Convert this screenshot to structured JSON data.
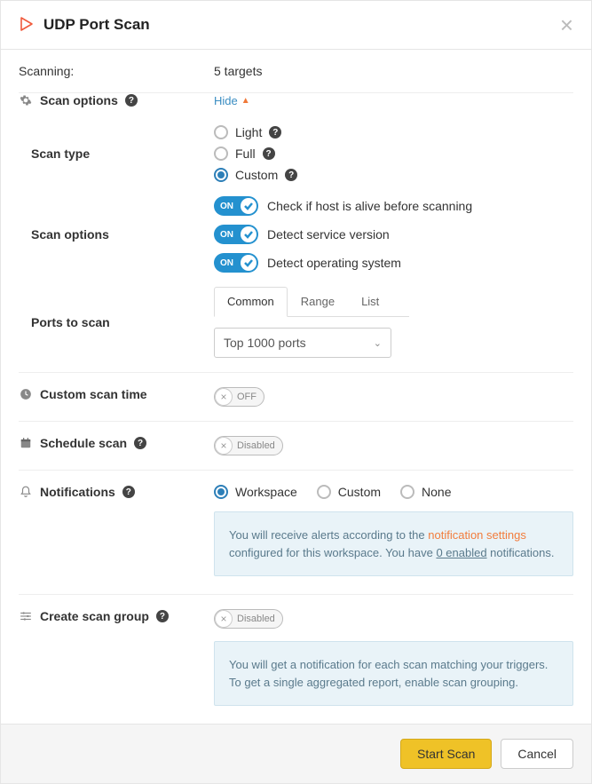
{
  "header": {
    "title": "UDP Port Scan"
  },
  "scanning": {
    "label": "Scanning:",
    "value": "5 targets"
  },
  "scan_options_header": {
    "label": "Scan options",
    "hide": "Hide"
  },
  "scan_type": {
    "label": "Scan type",
    "options": {
      "light": "Light",
      "full": "Full",
      "custom": "Custom"
    },
    "selected": "custom"
  },
  "scan_options": {
    "label": "Scan options",
    "toggles": {
      "alive": {
        "state": "ON",
        "text": "Check if host is alive before scanning"
      },
      "service": {
        "state": "ON",
        "text": "Detect service version"
      },
      "os": {
        "state": "ON",
        "text": "Detect operating system"
      }
    }
  },
  "ports": {
    "label": "Ports to scan",
    "tabs": {
      "common": "Common",
      "range": "Range",
      "list": "List"
    },
    "select": "Top 1000 ports"
  },
  "custom_time": {
    "label": "Custom scan time",
    "state": "OFF"
  },
  "schedule": {
    "label": "Schedule scan",
    "state": "Disabled"
  },
  "notifications": {
    "label": "Notifications",
    "options": {
      "workspace": "Workspace",
      "custom": "Custom",
      "none": "None"
    },
    "info_pre": "You will receive alerts according to the ",
    "info_link": "notification settings",
    "info_mid": " configured for this workspace. You have ",
    "info_count": "0 enabled",
    "info_post": " notifications."
  },
  "scan_group": {
    "label": "Create scan group",
    "state": "Disabled",
    "info": "You will get a notification for each scan matching your triggers. To get a single aggregated report, enable scan grouping."
  },
  "footer": {
    "start": "Start Scan",
    "cancel": "Cancel"
  }
}
